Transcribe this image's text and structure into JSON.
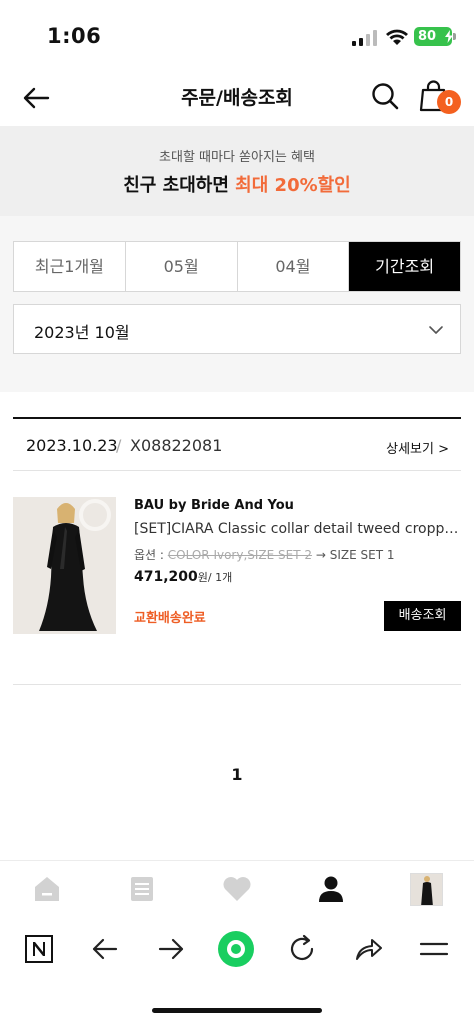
{
  "status_bar": {
    "time": "1:06",
    "battery": "80"
  },
  "header": {
    "title": "주문/배송조회",
    "cart_count": "0"
  },
  "banner": {
    "subtitle": "초대할 때마다 쏟아지는 혜택",
    "main_prefix": "친구 초대하면 ",
    "main_highlight": "최대 20%할인",
    "highlight_color": "#f26b3a"
  },
  "period_tabs": [
    {
      "label": "최근1개월",
      "active": false
    },
    {
      "label": "05월",
      "active": false
    },
    {
      "label": "04월",
      "active": false
    },
    {
      "label": "기간조회",
      "active": true
    }
  ],
  "month_select": {
    "value": "2023년 10월"
  },
  "order": {
    "date": "2023.10.23",
    "separator": "/",
    "number": "X08822081",
    "detail_link": "상세보기 >",
    "item": {
      "brand": "BAU by Bride And You",
      "name": "[SET]CIARA Classic collar detail tweed cropped...",
      "option_label": "옵션 : ",
      "option_old": "COLOR Ivory,SIZE SET 2",
      "option_arrow": " → ",
      "option_new": "SIZE SET 1",
      "price": "471,200",
      "price_unit": "원/ 1개",
      "status": "교환배송완료",
      "status_color": "#ee5d24",
      "track_button": "배송조회"
    }
  },
  "pagination": {
    "current": "1"
  },
  "app_tabbar": {
    "icons": [
      "home-icon",
      "list-icon",
      "heart-icon",
      "person-icon",
      "recent-product-thumbnail"
    ]
  },
  "browser_toolbar": {
    "icons": [
      "naver-n-icon",
      "back-arrow-icon",
      "forward-arrow-icon",
      "green-dot-icon",
      "refresh-icon",
      "share-icon",
      "menu-icon"
    ],
    "accent": "#19ce60"
  }
}
